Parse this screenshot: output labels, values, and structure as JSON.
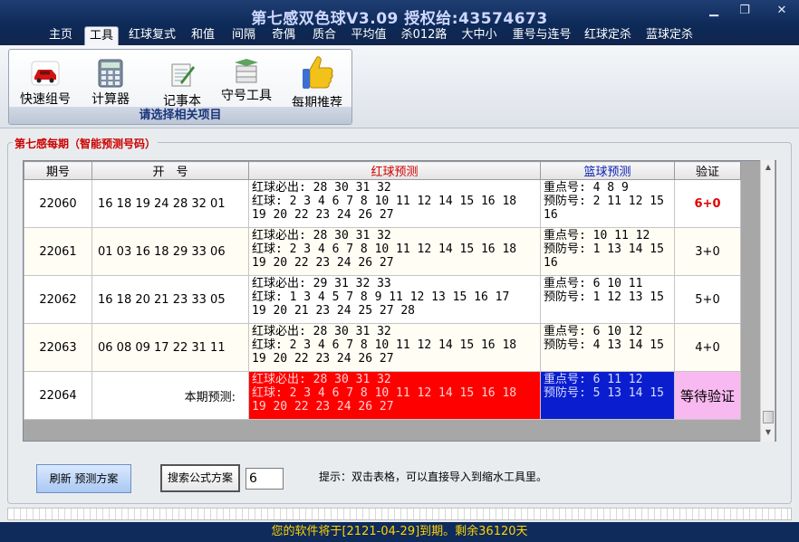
{
  "window": {
    "title": "第七感双色球V3.09  授权给:43574673"
  },
  "menu": [
    "主页",
    "工具",
    "红球复式",
    "和值",
    "间隔",
    "奇偶",
    "质合",
    "平均值",
    "杀012路",
    "大中小",
    "重号与连号",
    "红球定杀",
    "蓝球定杀"
  ],
  "menu_active": "工具",
  "toolbar": {
    "items": [
      {
        "label": "快速组号",
        "icon": "car-icon"
      },
      {
        "label": "计算器",
        "icon": "calculator-icon"
      },
      {
        "label": "记事本",
        "icon": "notepad-icon"
      },
      {
        "label": "守号工具",
        "icon": "stack-icon"
      },
      {
        "label": "每期推荐",
        "icon": "thumbs-up-icon"
      }
    ],
    "caption": "请选择相关项目"
  },
  "panel": {
    "legend": "第七感每期（智能预测号码）"
  },
  "table": {
    "headers": {
      "id": "期号",
      "draw": "开　号",
      "red": "红球预测",
      "blue": "篮球预测",
      "verify": "验证"
    },
    "rows": [
      {
        "id": "22060",
        "draw": "16 18 19 24 28 32 01",
        "red_must": "红球必出: 28 30 31 32",
        "red_line1": "红球: 2 3 4 6 7 8 10 11 12 14 15 16 18",
        "red_line2": "19 20 22 23 24 26 27",
        "blue_key": "重点号: 4 8 9",
        "blue_back1": "预防号: 2 11 12 15",
        "blue_back2": "16",
        "verify": "6+0",
        "verify_strong": true
      },
      {
        "id": "22061",
        "draw": "01 03 16 18 29 33 06",
        "red_must": "红球必出: 28 30 31 32",
        "red_line1": "红球: 2 3 4 6 7 8 10 11 12 14 15 16 18",
        "red_line2": "19 20 22 23 24 26 27",
        "blue_key": "重点号: 10 11 12",
        "blue_back1": "预防号: 1 13 14 15",
        "blue_back2": "16",
        "verify": "3+0",
        "verify_strong": false
      },
      {
        "id": "22062",
        "draw": "16 18 20 21 23 33 05",
        "red_must": "红球必出: 29 31 32 33",
        "red_line1": "红球: 1 3 4 5 7 8 9 11 12 13 15 16 17",
        "red_line2": "19 20 21 23 24 25 27 28",
        "blue_key": "重点号: 6 10 11",
        "blue_back1": "预防号: 1 12 13 15",
        "blue_back2": "",
        "verify": "5+0",
        "verify_strong": false
      },
      {
        "id": "22063",
        "draw": "06 08 09 17 22 31 11",
        "red_must": "红球必出: 28 30 31 32",
        "red_line1": "红球: 2 3 4 6 7 8 10 11 12 14 15 16 18",
        "red_line2": "19 20 22 23 24 26 27",
        "blue_key": "重点号: 6 10 12",
        "blue_back1": "预防号: 4 13 14 15",
        "blue_back2": "",
        "verify": "4+0",
        "verify_strong": false
      },
      {
        "id": "22064",
        "draw": "本期预测:",
        "red_must": "红球必出: 28 30 31 32",
        "red_line1": "红球: 2 3 4 6 7 8 10 11 12 14 15 16 18",
        "red_line2": "19 20 22 23 24 26 27",
        "blue_key": "重点号: 6 11 12",
        "blue_back1": "预防号: 5 13 14 15",
        "blue_back2": "",
        "verify": "等待验证",
        "verify_strong": false,
        "highlight": true
      }
    ]
  },
  "controls": {
    "refresh_label": "刷新 预测方案",
    "search_label": "搜索公式方案",
    "formula_value": "6",
    "hint": "提示：双击表格，可以直接导入到缩水工具里。"
  },
  "footer": {
    "text": "您的软件将于[2121-04-29]到期。剩余36120天"
  },
  "colors": {
    "title_bar": "#0d2a58",
    "red_highlight": "#ff0000",
    "blue_highlight": "#0b1ecf",
    "verify_pending": "#f8b9f0",
    "footer_text": "#ffd400"
  }
}
